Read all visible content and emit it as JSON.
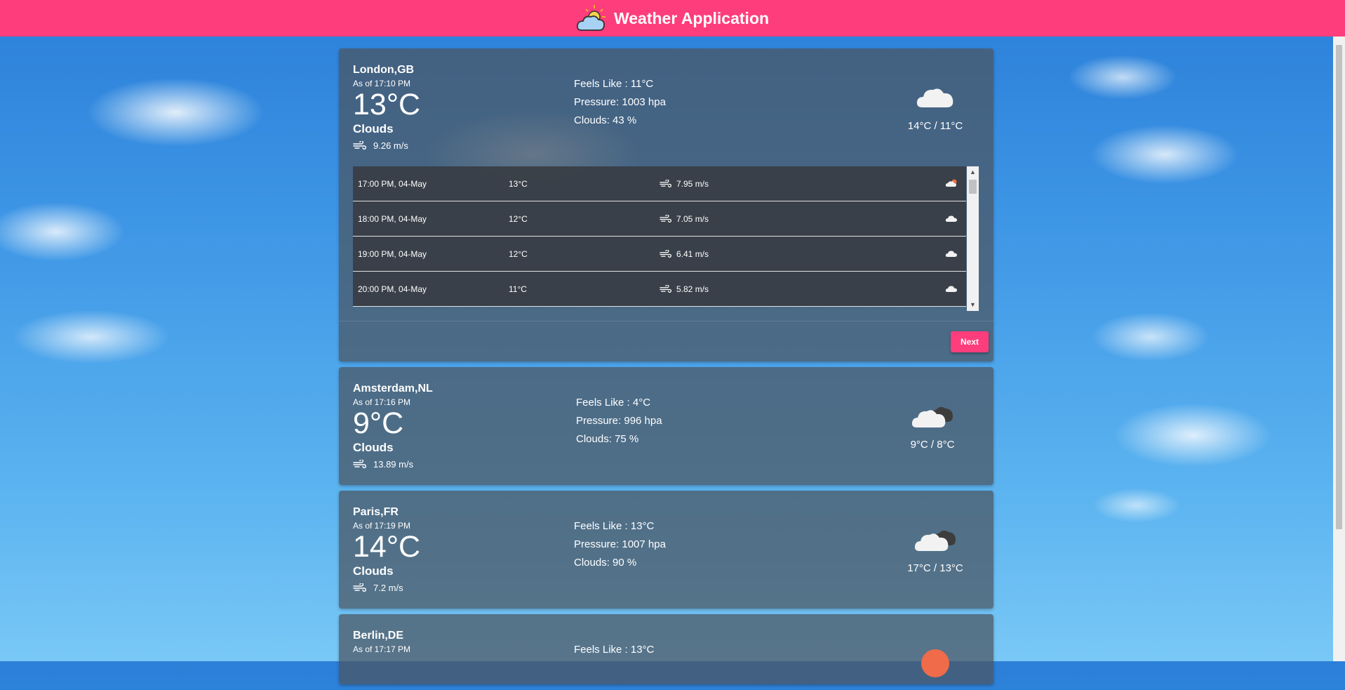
{
  "app": {
    "title": "Weather Application"
  },
  "cards": [
    {
      "city": "London,GB",
      "as_of": "As of 17:10 PM",
      "temp": "13°C",
      "condition": "Clouds",
      "wind": "9.26 m/s",
      "feels_like": "Feels Like : 11°C",
      "pressure": "Pressure: 1003 hpa",
      "clouds": "Clouds: 43 %",
      "min_max": "14°C / 11°C",
      "icon": "cloud-icon",
      "forecast": [
        {
          "time": "17:00 PM, 04-May",
          "temp": "13°C",
          "wind": "7.95 m/s",
          "icon": "cloud-sun-icon"
        },
        {
          "time": "18:00 PM, 04-May",
          "temp": "12°C",
          "wind": "7.05 m/s",
          "icon": "cloud-icon"
        },
        {
          "time": "19:00 PM, 04-May",
          "temp": "12°C",
          "wind": "6.41 m/s",
          "icon": "cloud-icon"
        },
        {
          "time": "20:00 PM, 04-May",
          "temp": "11°C",
          "wind": "5.82 m/s",
          "icon": "cloud-icon"
        }
      ],
      "next_label": "Next"
    },
    {
      "city": "Amsterdam,NL",
      "as_of": "As of 17:16 PM",
      "temp": "9°C",
      "condition": "Clouds",
      "wind": "13.89 m/s",
      "feels_like": "Feels Like : 4°C",
      "pressure": "Pressure: 996 hpa",
      "clouds": "Clouds: 75 %",
      "min_max": "9°C / 8°C",
      "icon": "broken-clouds-icon"
    },
    {
      "city": "Paris,FR",
      "as_of": "As of 17:19 PM",
      "temp": "14°C",
      "condition": "Clouds",
      "wind": "7.2 m/s",
      "feels_like": "Feels Like : 13°C",
      "pressure": "Pressure: 1007 hpa",
      "clouds": "Clouds: 90 %",
      "min_max": "17°C / 13°C",
      "icon": "broken-clouds-icon"
    },
    {
      "city": "Berlin,DE",
      "as_of": "As of 17:17 PM",
      "feels_like": "Feels Like : 13°C",
      "icon": "sun-icon"
    }
  ]
}
